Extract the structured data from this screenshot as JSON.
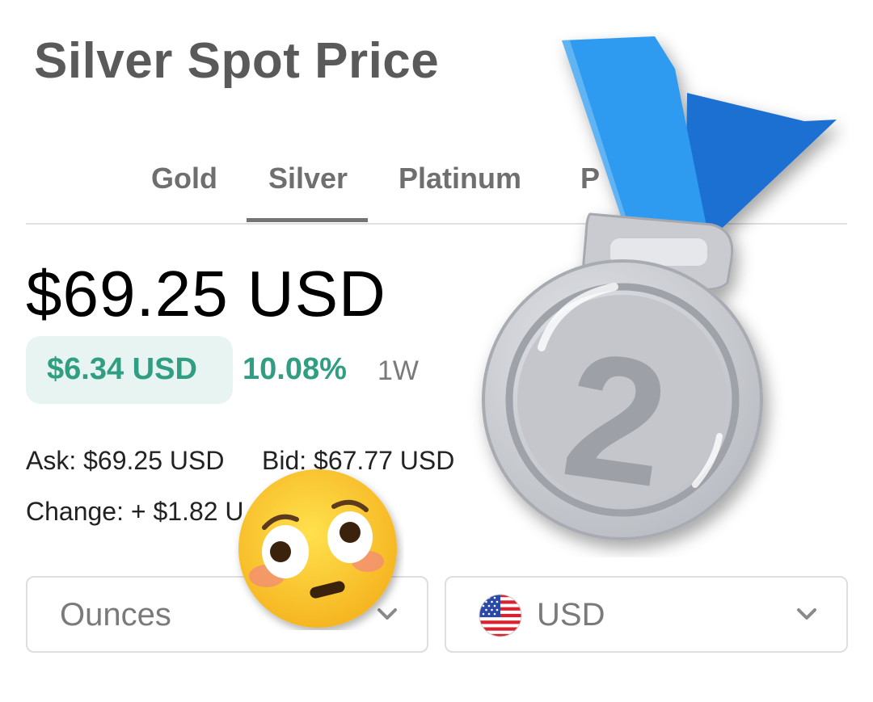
{
  "page": {
    "title": "Silver Spot Price"
  },
  "tabs": [
    {
      "label": "Gold"
    },
    {
      "label": "Silver",
      "active": true
    },
    {
      "label": "Platinum"
    },
    {
      "label": "P"
    }
  ],
  "price": {
    "current": "$69.25 USD",
    "change_amount": "$6.34 USD",
    "change_percent": "10.08%",
    "period": "1W"
  },
  "details": {
    "ask": "Ask: $69.25 USD",
    "bid": "Bid: $67.77 USD",
    "change": "Change: + $1.82 U"
  },
  "selects": {
    "units": {
      "value": "Ounces",
      "icon": "chevron-down-icon"
    },
    "currency": {
      "value": "USD",
      "icon": "us-flag-icon"
    }
  },
  "overlays": {
    "medal": {
      "label": "2",
      "icon": "silver-medal-icon"
    },
    "emoji": {
      "icon": "flushed-face-icon"
    }
  },
  "colors": {
    "positive": "#2f9e82",
    "badge_bg": "#e8f4f1",
    "title": "#5a5a5a",
    "medal_ribbon": "#2d8de8"
  }
}
